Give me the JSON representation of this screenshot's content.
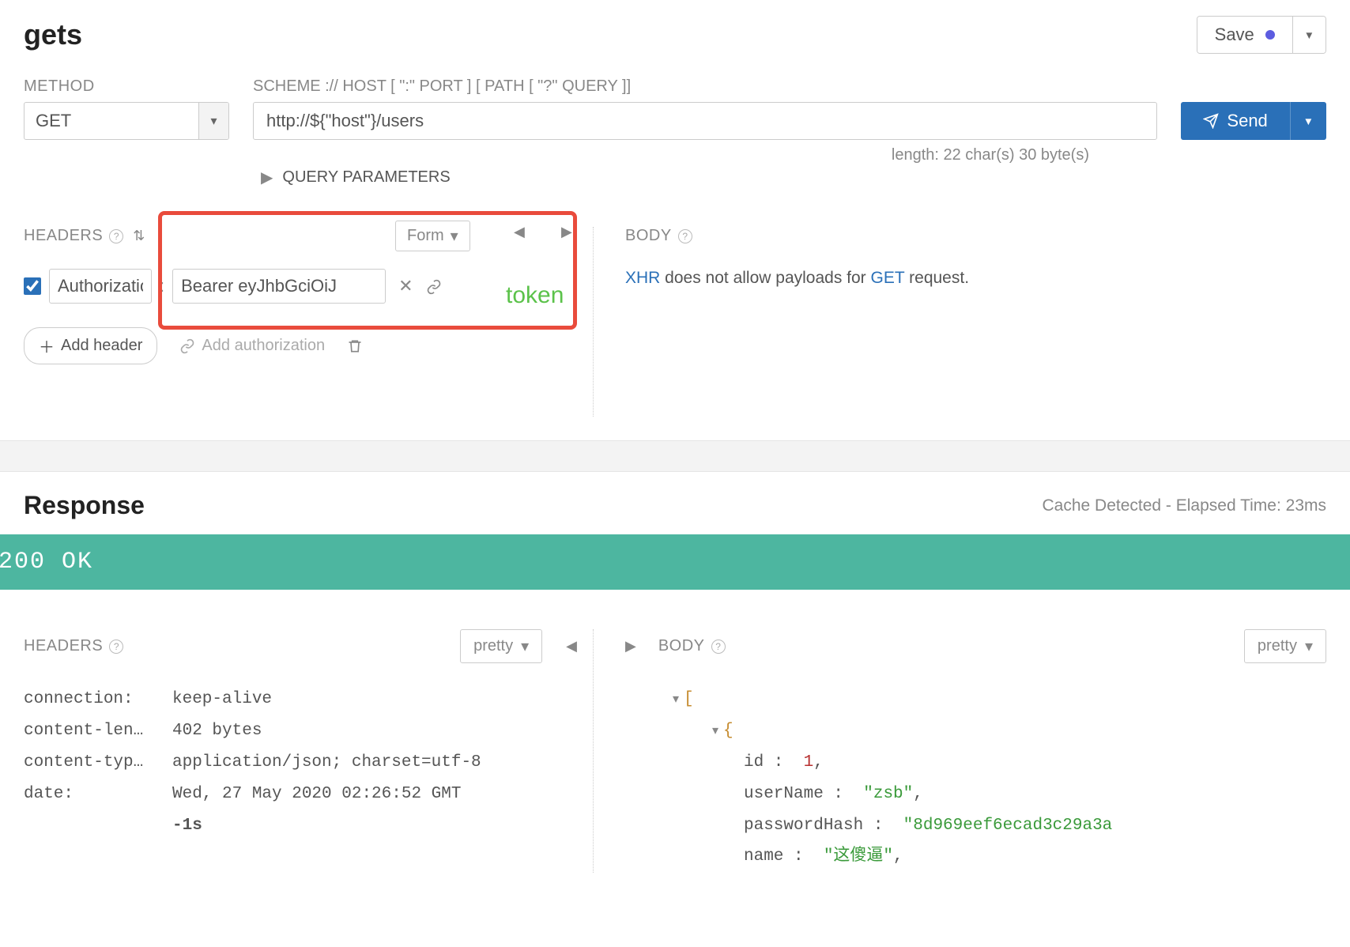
{
  "title": "gets",
  "save": {
    "label": "Save"
  },
  "method": {
    "label": "METHOD",
    "value": "GET"
  },
  "url": {
    "label": "SCHEME :// HOST [ \":\" PORT ] [ PATH [ \"?\" QUERY ]]",
    "value": "http://${\"host\"}/users",
    "meta": "length: 22 char(s) 30 byte(s)"
  },
  "send": {
    "label": "Send"
  },
  "queryParams": {
    "label": "QUERY PARAMETERS"
  },
  "headers": {
    "label": "HEADERS",
    "formLabel": "Form",
    "items": [
      {
        "enabled": true,
        "name": "Authorization",
        "value": "Bearer eyJhbGciOiJ"
      }
    ],
    "addHeader": "Add header",
    "addAuth": "Add authorization"
  },
  "annotation": {
    "token": "token"
  },
  "body": {
    "label": "BODY",
    "msgPrefix": "XHR",
    "msgMid": " does not allow payloads for ",
    "msgMethod": "GET",
    "msgSuffix": " request."
  },
  "response": {
    "title": "Response",
    "meta": "Cache Detected - Elapsed Time: 23ms",
    "status": "200 OK",
    "headersLabel": "HEADERS",
    "bodyLabel": "BODY",
    "prettyLabel": "pretty",
    "headers": {
      "connection": "keep-alive",
      "contentLengthKey": "content-len…",
      "contentLength": "402 bytes",
      "contentTypeKey": "content-typ…",
      "contentType": "application/json; charset=utf-8",
      "dateKey": "date:",
      "date": "Wed, 27 May 2020 02:26:52 GMT",
      "dateRel": "-1s"
    },
    "json": {
      "id": 1,
      "userName": "\"zsb\"",
      "passwordHash": "\"8d969eef6ecad3c29a3a",
      "name": "\"这傻逼\""
    }
  }
}
